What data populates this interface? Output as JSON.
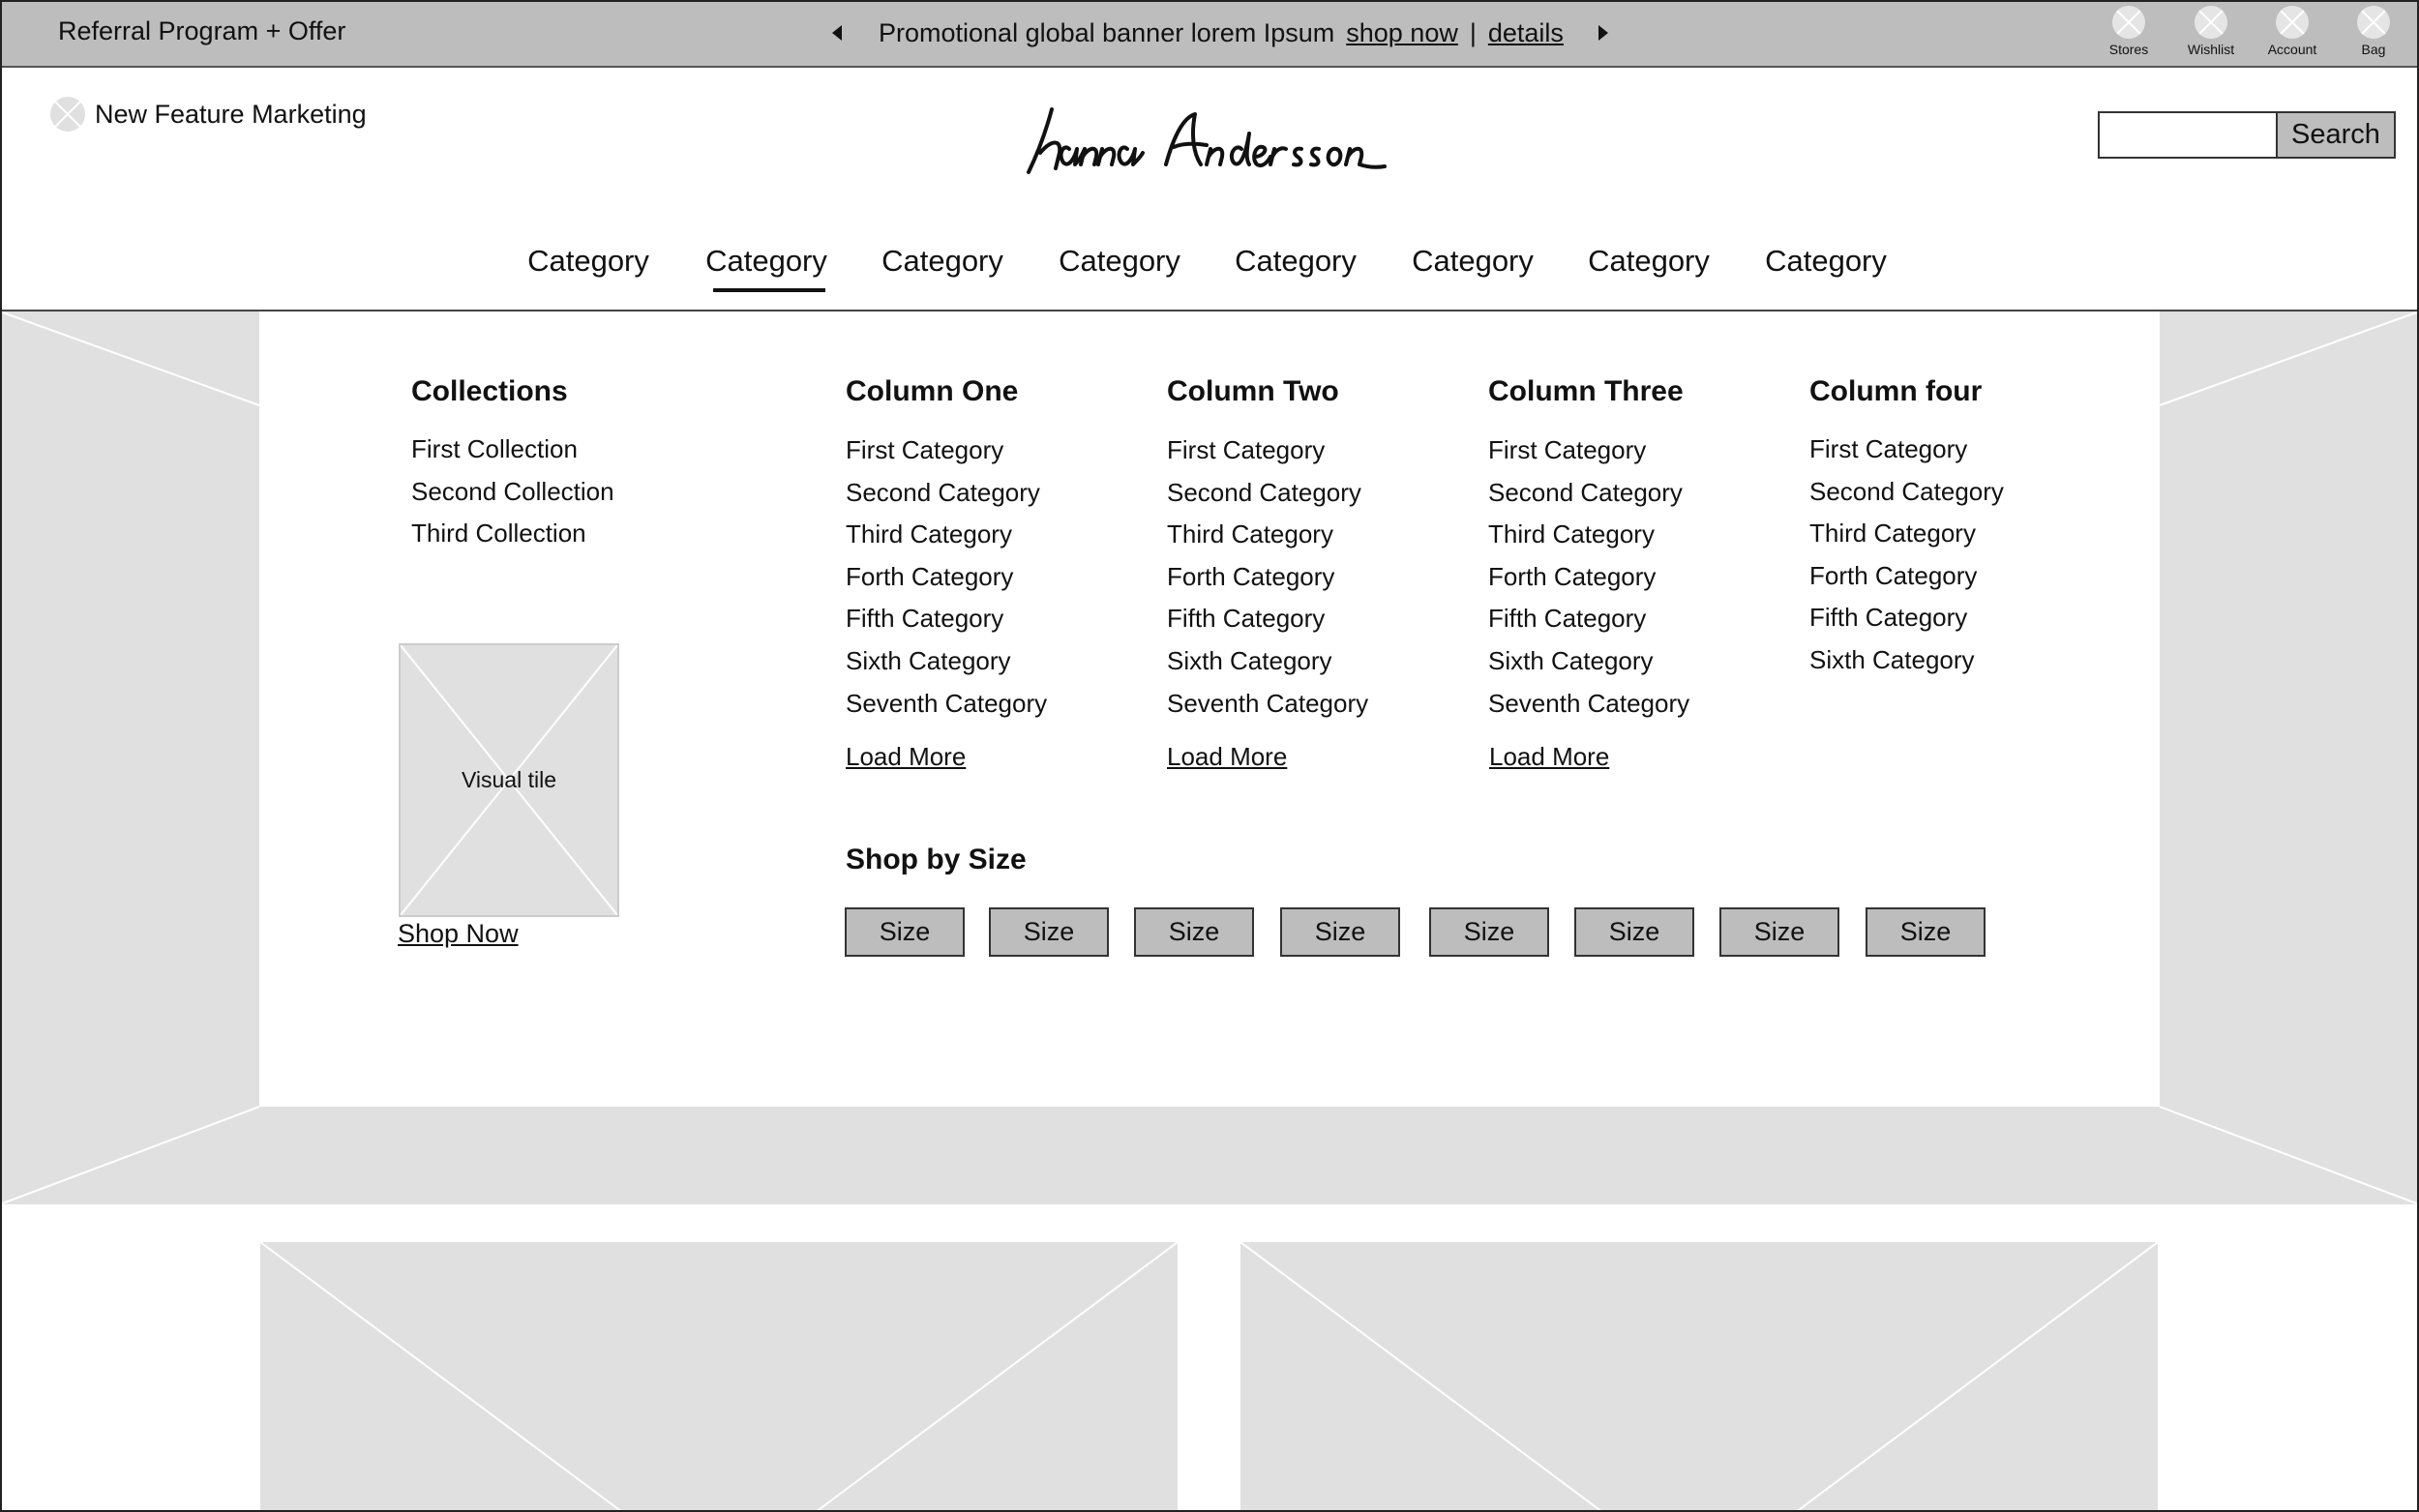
{
  "topbar": {
    "referral": "Referral Program + Offer",
    "promo_text": "Promotional global banner lorem Ipsum",
    "shop_now": "shop now",
    "separator": "|",
    "details": "details",
    "utilities": [
      {
        "label": "Stores",
        "icon": "stores-icon"
      },
      {
        "label": "Wishlist",
        "icon": "wishlist-icon"
      },
      {
        "label": "Account",
        "icon": "account-icon"
      },
      {
        "label": "Bag",
        "icon": "bag-icon"
      }
    ]
  },
  "header": {
    "new_feature": "New Feature Marketing",
    "logo_text": "hanna andersson",
    "search_value": "",
    "search_button": "Search"
  },
  "nav": {
    "categories": [
      "Category",
      "Category",
      "Category",
      "Category",
      "Category",
      "Category",
      "Category",
      "Category"
    ],
    "active_index": 1
  },
  "mega_menu": {
    "collections": {
      "title": "Collections",
      "items": [
        "First Collection",
        "Second Collection",
        "Third Collection"
      ]
    },
    "columns": [
      {
        "title": "Column One",
        "items": [
          "First Category",
          "Second Category",
          "Third Category",
          "Forth Category",
          "Fifth Category",
          "Sixth Category",
          "Seventh Category"
        ],
        "load_more": "Load More"
      },
      {
        "title": "Column Two",
        "items": [
          "First Category",
          "Second Category",
          "Third Category",
          "Forth Category",
          "Fifth Category",
          "Sixth Category",
          "Seventh Category"
        ],
        "load_more": "Load More"
      },
      {
        "title": "Column Three",
        "items": [
          "First Category",
          "Second Category",
          "Third Category",
          "Forth Category",
          "Fifth Category",
          "Sixth Category",
          "Seventh Category"
        ],
        "load_more": "Load More"
      },
      {
        "title": "Column four",
        "items": [
          "First Category",
          "Second Category",
          "Third Category",
          "Forth Category",
          "Fifth Category",
          "Sixth Category"
        ]
      }
    ],
    "visual_tile": {
      "label": "Visual tile",
      "link": "Shop Now"
    },
    "shop_by_size": {
      "title": "Shop by Size",
      "sizes": [
        "Size",
        "Size",
        "Size",
        "Size",
        "Size",
        "Size",
        "Size",
        "Size"
      ]
    }
  },
  "colors": {
    "banner_gray": "#bdbdbd",
    "placeholder_gray": "#e0e0e0",
    "text": "#111111"
  }
}
